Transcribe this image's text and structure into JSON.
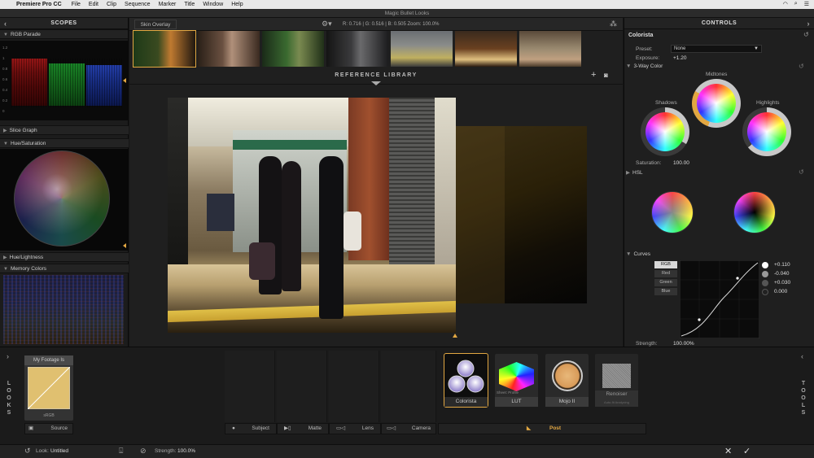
{
  "menubar": {
    "app_name": "Premiere Pro CC",
    "items": [
      "File",
      "Edit",
      "Clip",
      "Sequence",
      "Marker",
      "Title",
      "Window",
      "Help"
    ]
  },
  "window_title": "Magic Bullet Looks",
  "scopes": {
    "title": "SCOPES",
    "sections": [
      "RGB Parade",
      "Slice Graph",
      "Hue/Saturation",
      "Hue/Lightness",
      "Memory Colors"
    ],
    "parade_ticks": [
      "1.2",
      "1",
      "0.8",
      "0.6",
      "0.4",
      "0.2",
      "0"
    ]
  },
  "center": {
    "skin_overlay": "Skin Overlay",
    "readout": "R: 0.716  |  G: 0.516  |  B: 0.505    Zoom:  100.0%",
    "reference_library": "REFERENCE LIBRARY",
    "thumbnail_count": 7,
    "selected_thumbnail": 0
  },
  "controls": {
    "title": "CONTROLS",
    "tool_name": "Colorista",
    "preset_label": "Preset:",
    "preset_value": "None",
    "exposure_label": "Exposure:",
    "exposure_value": "+1.20",
    "three_way_label": "3-Way Color",
    "shadows_label": "Shadows",
    "midtones_label": "Midtones",
    "highlights_label": "Highlights",
    "saturation_label": "Saturation:",
    "saturation_value": "100.00",
    "hsl_label": "HSL",
    "curves_label": "Curves",
    "curve_channels": [
      "RGB",
      "Red",
      "Green",
      "Blue"
    ],
    "curve_values": [
      "+0.110",
      "-0.040",
      "+0.030",
      "0.000"
    ],
    "strength_label": "Strength:",
    "strength_value": "100.00%"
  },
  "bottom": {
    "looks_label": "LOOKS",
    "tools_label": "TOOLS",
    "footage_label": "My Footage Is",
    "footage_space": "sRGB",
    "source_label": "Source",
    "categories": [
      "Subject",
      "Matte",
      "Lens",
      "Camera",
      "Post"
    ],
    "tools": [
      {
        "name": "Colorista"
      },
      {
        "name": "LUT",
        "sub": "Sheet: Profile"
      },
      {
        "name": "Mojo II"
      },
      {
        "name": "Renoiser",
        "sub": "Auto-fit Analyzing"
      }
    ]
  },
  "status": {
    "look_label": "Look:",
    "look_value": "Untitled",
    "strength_label": "Strength:",
    "strength_value": "100.0%"
  },
  "colors": {
    "accent": "#e2a742",
    "panel": "#1f1f1f",
    "menubar": "#e8e8e8"
  }
}
